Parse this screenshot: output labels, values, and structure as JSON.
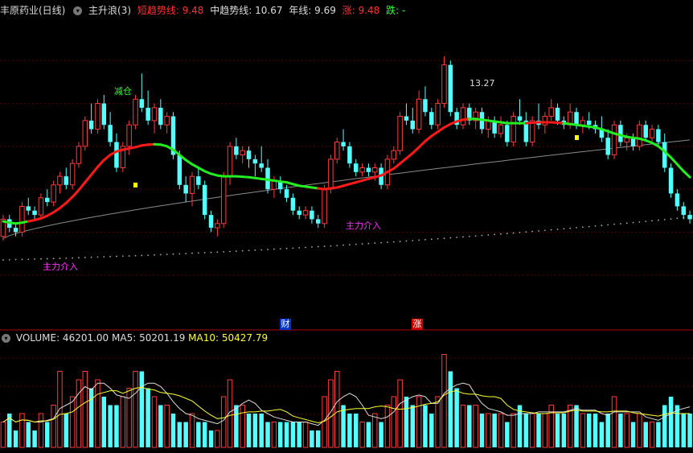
{
  "header": {
    "stock_title": "丰原药业(日线)",
    "indicator_name": "主升浪(3)",
    "short_trend_label": "短趋势线: 9.48",
    "mid_trend_label": "中趋势线: 10.67",
    "year_line_label": "年线: 9.69",
    "up_label": "涨: 9.48",
    "down_label": "跌: -",
    "colors": {
      "short": "#ff3333",
      "mid": "#dddddd",
      "year": "#dddddd",
      "up": "#ff3333",
      "down": "#33ff33"
    }
  },
  "annotations": {
    "reduce_position": "减仓",
    "main_force_1": "主力介入",
    "main_force_2": "主力介入",
    "high_marker": "13.27"
  },
  "event_badges": {
    "cai": "财",
    "zhang": "涨"
  },
  "volume_header": {
    "volume_label": "VOLUME: 46201.00",
    "ma5_label": "MA5: 50201.19",
    "ma10_label": "MA10: 50427.79"
  },
  "chart_data": {
    "type": "candlestick",
    "price_range": [
      7.2,
      14.2
    ],
    "candles": [
      [
        9.1,
        9.6,
        9.0,
        9.5,
        1
      ],
      [
        9.5,
        9.6,
        9.2,
        9.3,
        0
      ],
      [
        9.3,
        9.4,
        9.1,
        9.2,
        0
      ],
      [
        9.2,
        9.9,
        9.1,
        9.8,
        1
      ],
      [
        9.8,
        10.0,
        9.6,
        9.7,
        0
      ],
      [
        9.7,
        9.8,
        9.5,
        9.6,
        0
      ],
      [
        9.6,
        10.1,
        9.5,
        10.0,
        1
      ],
      [
        10.0,
        10.2,
        9.8,
        9.9,
        0
      ],
      [
        9.9,
        10.4,
        9.8,
        10.3,
        1
      ],
      [
        10.3,
        10.6,
        10.1,
        10.5,
        1
      ],
      [
        10.5,
        10.7,
        10.2,
        10.3,
        0
      ],
      [
        10.3,
        10.9,
        10.2,
        10.8,
        1
      ],
      [
        10.8,
        11.3,
        10.7,
        11.2,
        1
      ],
      [
        11.2,
        11.9,
        11.1,
        11.8,
        1
      ],
      [
        11.8,
        12.2,
        11.5,
        11.6,
        0
      ],
      [
        11.6,
        12.3,
        11.5,
        12.2,
        1
      ],
      [
        12.2,
        12.4,
        11.6,
        11.7,
        0
      ],
      [
        11.7,
        12.0,
        11.2,
        11.3,
        0
      ],
      [
        11.3,
        11.5,
        10.6,
        10.7,
        0
      ],
      [
        10.7,
        11.3,
        10.6,
        11.2,
        1
      ],
      [
        11.2,
        11.8,
        11.0,
        11.7,
        1
      ],
      [
        11.7,
        12.4,
        11.6,
        12.3,
        1
      ],
      [
        12.3,
        12.9,
        12.0,
        12.1,
        0
      ],
      [
        12.1,
        12.5,
        11.7,
        11.8,
        0
      ],
      [
        11.8,
        12.2,
        11.5,
        12.1,
        1
      ],
      [
        12.1,
        12.3,
        11.6,
        11.7,
        0
      ],
      [
        11.7,
        12.0,
        11.5,
        11.9,
        1
      ],
      [
        11.9,
        12.0,
        10.9,
        11.0,
        0
      ],
      [
        11.0,
        11.1,
        10.2,
        10.3,
        0
      ],
      [
        10.3,
        10.5,
        9.9,
        10.1,
        0
      ],
      [
        10.1,
        10.6,
        9.8,
        10.5,
        1
      ],
      [
        10.5,
        10.7,
        10.2,
        10.3,
        0
      ],
      [
        10.3,
        10.4,
        9.5,
        9.6,
        0
      ],
      [
        9.6,
        9.7,
        9.2,
        9.3,
        0
      ],
      [
        9.3,
        9.5,
        9.1,
        9.4,
        1
      ],
      [
        9.4,
        10.6,
        9.3,
        10.5,
        1
      ],
      [
        10.5,
        11.3,
        10.3,
        11.2,
        1
      ],
      [
        11.2,
        11.4,
        10.9,
        11.0,
        0
      ],
      [
        11.0,
        11.2,
        10.8,
        11.1,
        1
      ],
      [
        11.1,
        11.2,
        10.7,
        10.9,
        0
      ],
      [
        10.9,
        11.0,
        10.5,
        10.8,
        0
      ],
      [
        10.8,
        11.2,
        10.6,
        10.7,
        0
      ],
      [
        10.7,
        10.9,
        10.1,
        10.2,
        0
      ],
      [
        10.2,
        10.5,
        10.0,
        10.4,
        1
      ],
      [
        10.4,
        10.5,
        10.1,
        10.2,
        0
      ],
      [
        10.2,
        10.3,
        9.9,
        10.0,
        0
      ],
      [
        10.0,
        10.1,
        9.6,
        9.7,
        0
      ],
      [
        9.7,
        9.8,
        9.5,
        9.6,
        0
      ],
      [
        9.6,
        9.8,
        9.5,
        9.7,
        1
      ],
      [
        9.7,
        9.8,
        9.4,
        9.5,
        0
      ],
      [
        9.5,
        9.6,
        9.3,
        9.4,
        0
      ],
      [
        9.4,
        10.3,
        9.3,
        10.2,
        1
      ],
      [
        10.2,
        11.0,
        10.1,
        10.9,
        1
      ],
      [
        10.9,
        11.4,
        10.8,
        11.3,
        1
      ],
      [
        11.3,
        11.6,
        11.1,
        11.2,
        0
      ],
      [
        11.2,
        11.3,
        10.7,
        10.8,
        0
      ],
      [
        10.8,
        10.9,
        10.5,
        10.6,
        0
      ],
      [
        10.6,
        10.8,
        10.5,
        10.7,
        1
      ],
      [
        10.7,
        10.8,
        10.5,
        10.6,
        0
      ],
      [
        10.6,
        10.8,
        10.4,
        10.7,
        1
      ],
      [
        10.7,
        10.8,
        10.2,
        10.3,
        0
      ],
      [
        10.3,
        11.0,
        10.2,
        10.9,
        1
      ],
      [
        10.9,
        11.2,
        10.8,
        11.1,
        1
      ],
      [
        11.1,
        12.0,
        11.0,
        11.9,
        1
      ],
      [
        11.9,
        12.2,
        11.7,
        11.8,
        0
      ],
      [
        11.8,
        12.1,
        11.5,
        11.6,
        0
      ],
      [
        11.6,
        12.5,
        11.5,
        12.3,
        1
      ],
      [
        12.3,
        12.6,
        11.9,
        12.0,
        0
      ],
      [
        12.0,
        12.1,
        11.6,
        11.7,
        0
      ],
      [
        11.7,
        12.3,
        11.6,
        12.2,
        1
      ],
      [
        12.2,
        13.3,
        12.1,
        13.1,
        1
      ],
      [
        13.1,
        13.2,
        11.9,
        12.0,
        0
      ],
      [
        12.0,
        12.1,
        11.6,
        11.7,
        0
      ],
      [
        11.7,
        12.2,
        11.6,
        12.1,
        1
      ],
      [
        12.1,
        12.2,
        11.7,
        11.8,
        0
      ],
      [
        11.8,
        12.1,
        11.6,
        12.0,
        1
      ],
      [
        12.0,
        12.1,
        11.5,
        11.6,
        0
      ],
      [
        11.6,
        11.9,
        11.4,
        11.8,
        1
      ],
      [
        11.8,
        11.9,
        11.4,
        11.5,
        0
      ],
      [
        11.5,
        11.9,
        11.4,
        11.7,
        1
      ],
      [
        11.7,
        11.8,
        11.2,
        11.3,
        0
      ],
      [
        11.3,
        12.0,
        11.2,
        11.9,
        1
      ],
      [
        11.9,
        12.3,
        11.7,
        11.8,
        0
      ],
      [
        11.8,
        12.0,
        11.2,
        11.3,
        0
      ],
      [
        11.3,
        11.9,
        11.2,
        11.8,
        1
      ],
      [
        11.8,
        12.2,
        11.6,
        11.7,
        0
      ],
      [
        11.7,
        12.0,
        11.5,
        11.9,
        1
      ],
      [
        11.9,
        12.3,
        11.8,
        12.1,
        1
      ],
      [
        12.1,
        12.2,
        11.7,
        11.8,
        0
      ],
      [
        11.8,
        11.9,
        11.6,
        11.7,
        0
      ],
      [
        11.7,
        12.2,
        11.6,
        12.0,
        1
      ],
      [
        12.0,
        12.1,
        11.6,
        11.7,
        0
      ],
      [
        11.7,
        11.9,
        11.5,
        11.8,
        1
      ],
      [
        11.8,
        12.0,
        11.6,
        11.7,
        0
      ],
      [
        11.7,
        11.8,
        11.5,
        11.6,
        0
      ],
      [
        11.6,
        11.9,
        11.3,
        11.4,
        0
      ],
      [
        11.4,
        11.6,
        10.9,
        11.0,
        0
      ],
      [
        11.0,
        11.8,
        10.9,
        11.7,
        1
      ],
      [
        11.7,
        11.8,
        11.2,
        11.3,
        0
      ],
      [
        11.3,
        11.5,
        11.1,
        11.4,
        1
      ],
      [
        11.4,
        11.5,
        11.1,
        11.2,
        0
      ],
      [
        11.2,
        11.8,
        11.1,
        11.7,
        1
      ],
      [
        11.7,
        11.8,
        11.3,
        11.4,
        0
      ],
      [
        11.4,
        11.7,
        11.3,
        11.6,
        1
      ],
      [
        11.6,
        11.7,
        11.2,
        11.3,
        0
      ],
      [
        11.3,
        11.5,
        10.6,
        10.7,
        0
      ],
      [
        10.7,
        10.8,
        10.0,
        10.1,
        0
      ],
      [
        10.1,
        10.2,
        9.7,
        9.8,
        0
      ],
      [
        9.8,
        9.9,
        9.5,
        9.6,
        0
      ],
      [
        9.6,
        9.7,
        9.4,
        9.5,
        0
      ]
    ],
    "short_trend": [
      9.45,
      9.42,
      9.4,
      9.42,
      9.45,
      9.48,
      9.52,
      9.58,
      9.66,
      9.76,
      9.88,
      10.02,
      10.18,
      10.36,
      10.54,
      10.72,
      10.88,
      11.0,
      11.08,
      11.12,
      11.15,
      11.18,
      11.22,
      11.24,
      11.25,
      11.24,
      11.2,
      11.12,
      11.0,
      10.88,
      10.78,
      10.7,
      10.62,
      10.56,
      10.52,
      10.5,
      10.5,
      10.5,
      10.49,
      10.48,
      10.46,
      10.44,
      10.42,
      10.4,
      10.38,
      10.36,
      10.32,
      10.28,
      10.26,
      10.24,
      10.22,
      10.2,
      10.22,
      10.24,
      10.28,
      10.32,
      10.36,
      10.4,
      10.44,
      10.48,
      10.52,
      10.6,
      10.68,
      10.8,
      10.92,
      11.04,
      11.18,
      11.32,
      11.44,
      11.54,
      11.64,
      11.72,
      11.78,
      11.82,
      11.84,
      11.84,
      11.82,
      11.8,
      11.78,
      11.76,
      11.74,
      11.74,
      11.74,
      11.74,
      11.75,
      11.76,
      11.76,
      11.76,
      11.75,
      11.74,
      11.72,
      11.7,
      11.68,
      11.66,
      11.64,
      11.6,
      11.55,
      11.5,
      11.46,
      11.42,
      11.4,
      11.38,
      11.34,
      11.28,
      11.2,
      11.08,
      10.94,
      10.78,
      10.62,
      10.48
    ],
    "short_trend_up": [
      0,
      0,
      0,
      0,
      0,
      1,
      1,
      1,
      1,
      1,
      1,
      1,
      1,
      1,
      1,
      1,
      1,
      1,
      1,
      1,
      1,
      1,
      1,
      1,
      1,
      0,
      0,
      0,
      0,
      0,
      0,
      0,
      0,
      0,
      0,
      0,
      0,
      0,
      0,
      0,
      0,
      0,
      0,
      0,
      0,
      0,
      0,
      0,
      0,
      0,
      0,
      1,
      1,
      1,
      1,
      1,
      1,
      1,
      1,
      1,
      1,
      1,
      1,
      1,
      1,
      1,
      1,
      1,
      1,
      1,
      1,
      1,
      1,
      1,
      1,
      0,
      0,
      0,
      0,
      0,
      0,
      0,
      0,
      0,
      1,
      1,
      1,
      1,
      1,
      1,
      0,
      0,
      0,
      0,
      0,
      0,
      0,
      0,
      0,
      0,
      0,
      0,
      0,
      0,
      0,
      0,
      0,
      0,
      0,
      0
    ],
    "mid_trend_start": 9.05,
    "mid_trend_end": 11.35,
    "year_line_start": 8.55,
    "year_line_end": 9.55,
    "volume": [
      3,
      4,
      2,
      4,
      3,
      2,
      4,
      3,
      5,
      9,
      4,
      6,
      8,
      9,
      7,
      8,
      6,
      5,
      5,
      6,
      7,
      9,
      9,
      7,
      6,
      5,
      5,
      4,
      3,
      3,
      4,
      3,
      3,
      2,
      2,
      6,
      8,
      5,
      5,
      4,
      4,
      4,
      3,
      3,
      3,
      3,
      3,
      3,
      3,
      2,
      2,
      6,
      8,
      9,
      5,
      4,
      4,
      3,
      3,
      4,
      3,
      5,
      6,
      8,
      6,
      5,
      6,
      5,
      4,
      6,
      11,
      9,
      7,
      5,
      5,
      5,
      4,
      4,
      4,
      4,
      3,
      4,
      5,
      4,
      4,
      4,
      4,
      5,
      4,
      4,
      5,
      5,
      4,
      4,
      4,
      3,
      4,
      6,
      4,
      4,
      3,
      4,
      3,
      3,
      3,
      5,
      6,
      5,
      4,
      4
    ],
    "volume_max": 12
  }
}
